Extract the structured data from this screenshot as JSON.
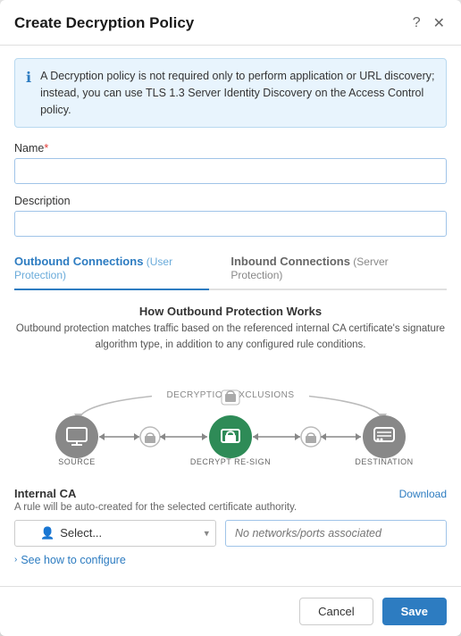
{
  "modal": {
    "title": "Create Decryption Policy",
    "help_icon": "?",
    "close_icon": "✕"
  },
  "info_banner": {
    "text": "A Decryption policy is not required only to perform application or URL discovery; instead, you can use TLS 1.3 Server Identity Discovery on the Access Control policy."
  },
  "form": {
    "name_label": "Name",
    "name_required": "*",
    "name_placeholder": "",
    "description_label": "Description",
    "description_placeholder": ""
  },
  "tabs": [
    {
      "id": "outbound",
      "main": "Outbound Connections",
      "sub": " (User Protection)",
      "active": true
    },
    {
      "id": "inbound",
      "main": "Inbound Connections",
      "sub": " (Server Protection)",
      "active": false
    }
  ],
  "outbound": {
    "section_title": "How Outbound Protection Works",
    "section_desc": "Outbound protection matches traffic based on the referenced internal CA certificate's signature algorithm type, in addition to any configured rule conditions.",
    "diagram_label_exclusions": "DECRYPTION EXCLUSIONS",
    "diagram_label_source": "SOURCE",
    "diagram_label_decrypt": "DECRYPT RE-SIGN",
    "diagram_label_destination": "DESTINATION"
  },
  "ca": {
    "label": "Internal CA",
    "download_label": "Download",
    "desc": "A rule will be auto-created for the selected certificate authority.",
    "select_placeholder": "Select...",
    "networks_placeholder": "No networks/ports associated"
  },
  "configure_link": "See how to configure",
  "footer": {
    "cancel_label": "Cancel",
    "save_label": "Save"
  }
}
